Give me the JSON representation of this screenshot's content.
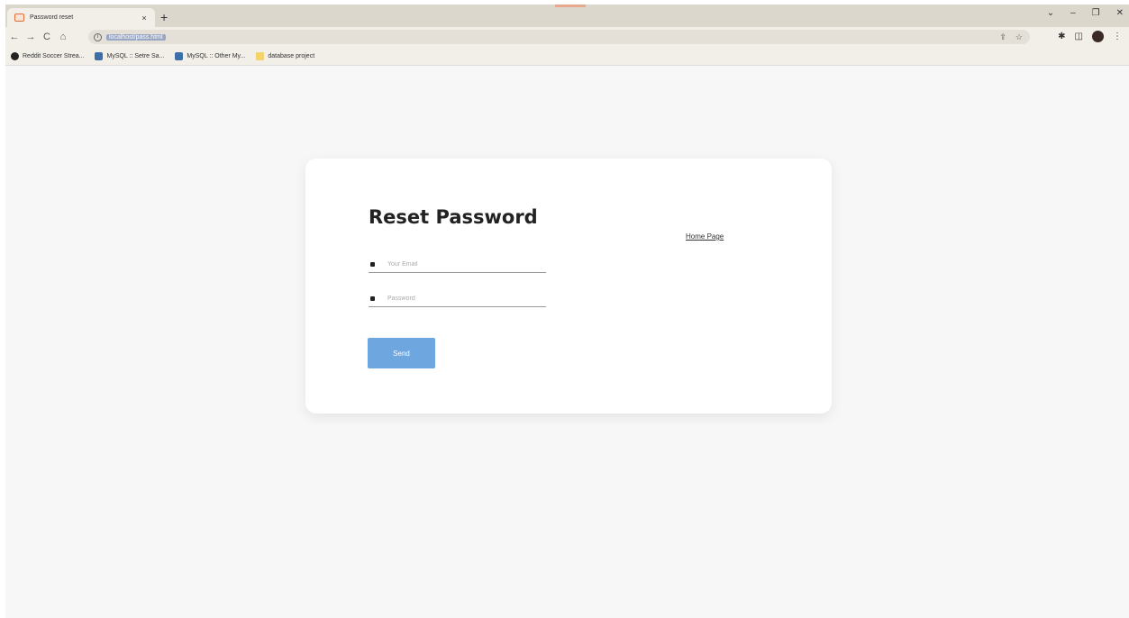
{
  "browser": {
    "tab_title": "Password reset",
    "tab_close": "×",
    "new_tab": "+",
    "url": "localhost/pass.html",
    "window_controls": [
      "⌄",
      "–",
      "❐",
      "✕"
    ],
    "nav": [
      "←",
      "→",
      "C",
      "⌂"
    ],
    "bookmarks": [
      {
        "label": "Reddit Soccer Strea...",
        "icon": "circle-dark"
      },
      {
        "label": "MySQL :: Setre Sa...",
        "icon": "mysql-blue"
      },
      {
        "label": "MySQL :: Other My...",
        "icon": "mysql-blue"
      },
      {
        "label": "database project",
        "icon": "folder"
      }
    ]
  },
  "page": {
    "title": "Reset Password",
    "home_link": "Home Page",
    "email_placeholder": "Your Email",
    "password_placeholder": "Password",
    "send_label": "Send"
  }
}
